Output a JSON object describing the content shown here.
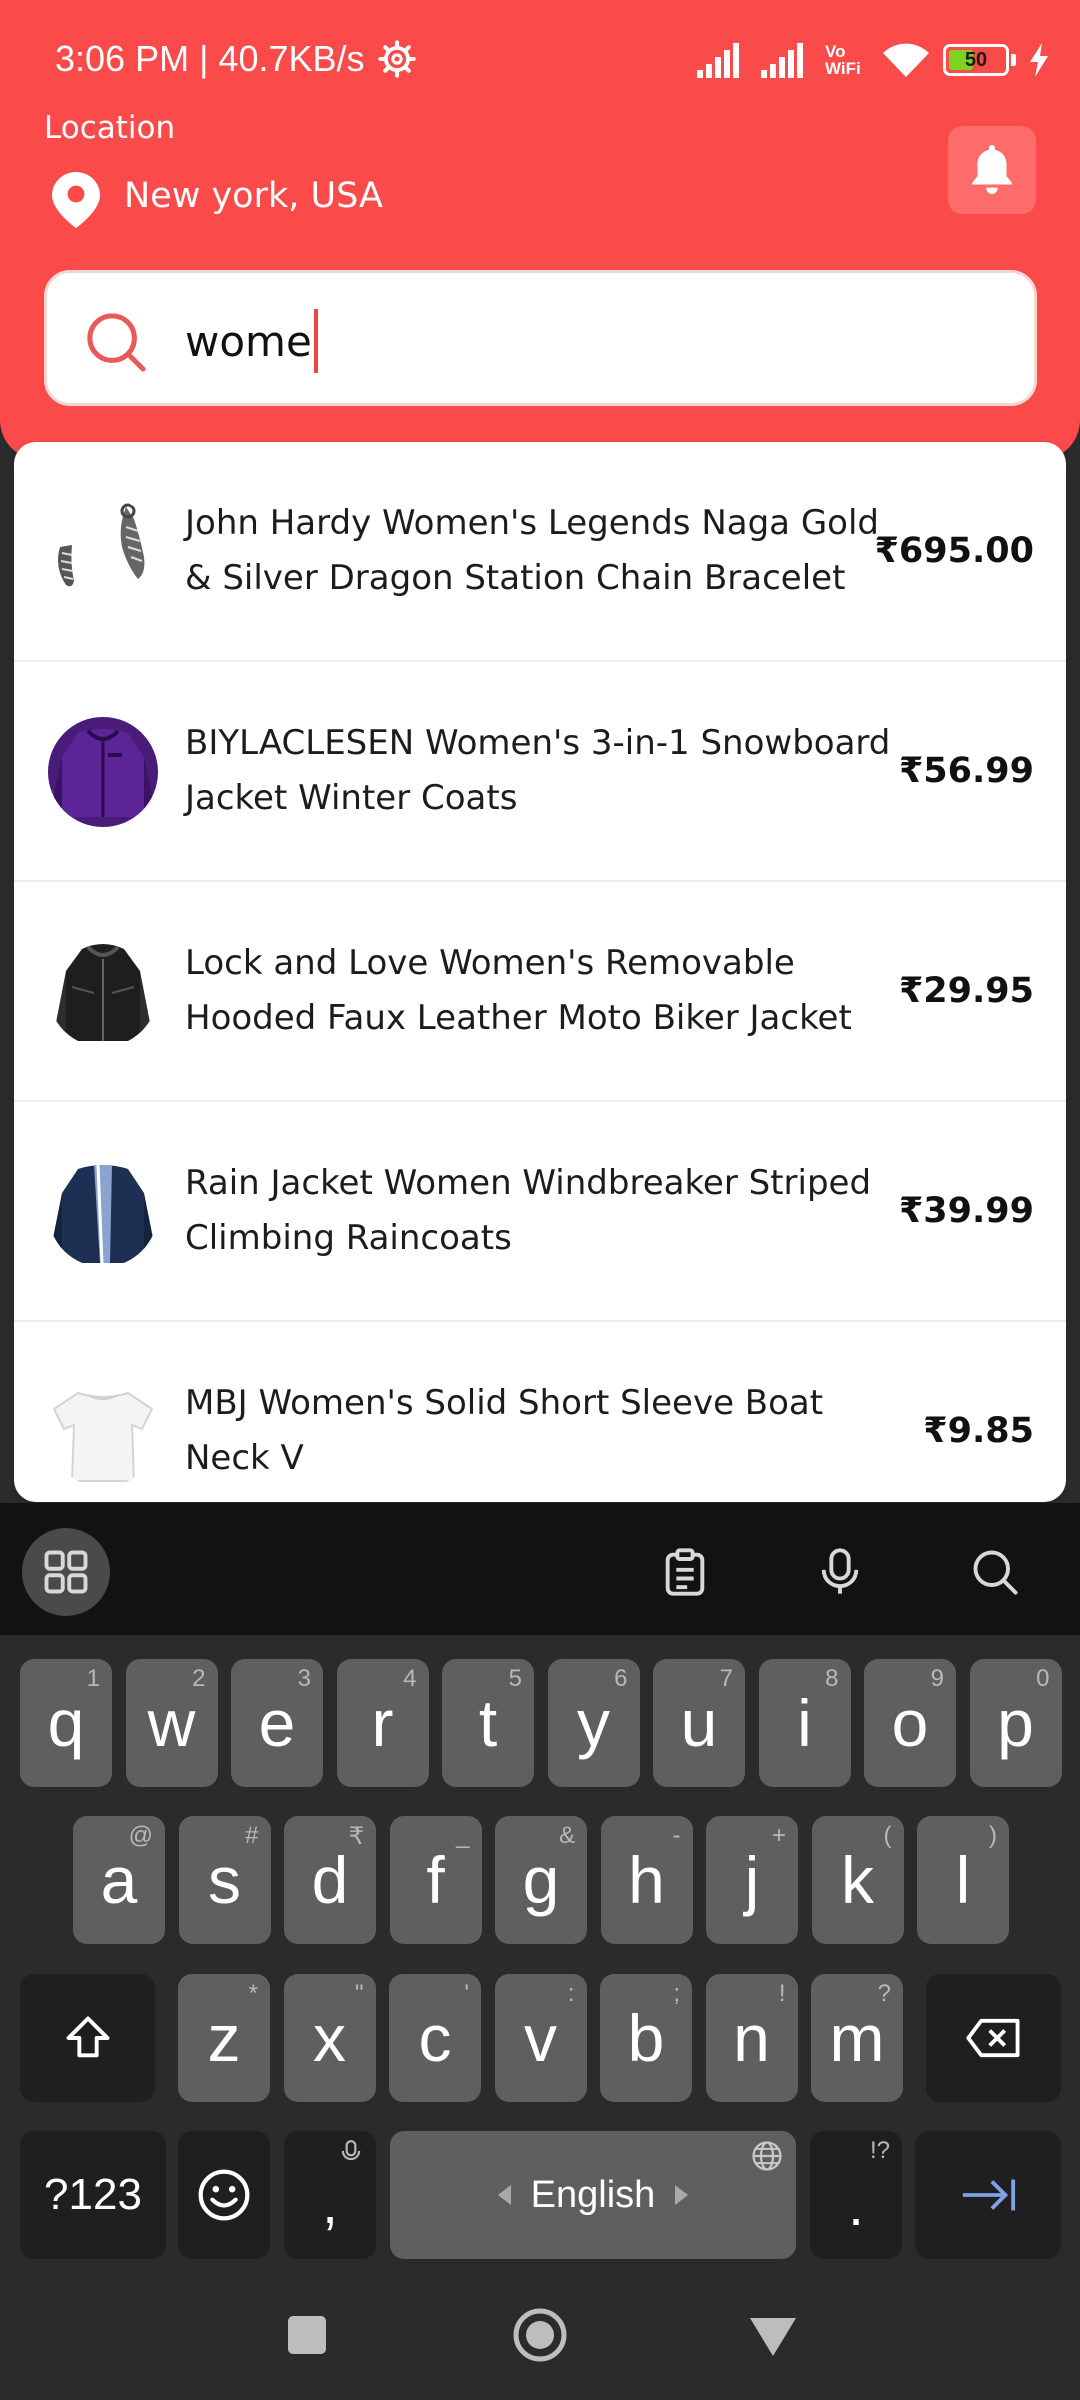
{
  "status_bar": {
    "time": "3:06 PM | 40.7KB/s",
    "vowifi_line1": "Vo",
    "vowifi_line2": "WiFi",
    "battery_level": "50",
    "battery_fraction": 0.5,
    "battery_color": "#7ed321"
  },
  "header": {
    "location_label": "Location",
    "location_value": "New york, USA",
    "accent_color": "#fb4a4a"
  },
  "search": {
    "value": "wome"
  },
  "results": [
    {
      "title": "John Hardy Women's Legends Naga Gold & Silver Dragon Station Chain Bracelet",
      "price": "₹695.00",
      "thumb_icon": "bracelet-thumbnail"
    },
    {
      "title": "BIYLACLESEN Women's 3-in-1 Snowboard Jacket Winter Coats",
      "price": "₹56.99",
      "thumb_icon": "purple-jacket-thumbnail"
    },
    {
      "title": "Lock and Love Women's Removable Hooded Faux Leather Moto Biker Jacket",
      "price": "₹29.95",
      "thumb_icon": "black-leather-jacket-thumbnail"
    },
    {
      "title": "Rain Jacket Women Windbreaker Striped Climbing Raincoats",
      "price": "₹39.99",
      "thumb_icon": "navy-raincoat-thumbnail"
    },
    {
      "title": "MBJ Women's Solid Short Sleeve Boat Neck V",
      "price": "₹9.85",
      "thumb_icon": "white-tshirt-thumbnail"
    }
  ],
  "keyboard": {
    "row1": [
      {
        "k": "q",
        "h": "1"
      },
      {
        "k": "w",
        "h": "2"
      },
      {
        "k": "e",
        "h": "3"
      },
      {
        "k": "r",
        "h": "4"
      },
      {
        "k": "t",
        "h": "5"
      },
      {
        "k": "y",
        "h": "6"
      },
      {
        "k": "u",
        "h": "7"
      },
      {
        "k": "i",
        "h": "8"
      },
      {
        "k": "o",
        "h": "9"
      },
      {
        "k": "p",
        "h": "0"
      }
    ],
    "row2": [
      {
        "k": "a",
        "h": "@"
      },
      {
        "k": "s",
        "h": "#"
      },
      {
        "k": "d",
        "h": "₹"
      },
      {
        "k": "f",
        "h": "_"
      },
      {
        "k": "g",
        "h": "&"
      },
      {
        "k": "h",
        "h": "-"
      },
      {
        "k": "j",
        "h": "+"
      },
      {
        "k": "k",
        "h": "("
      },
      {
        "k": "l",
        "h": ")"
      }
    ],
    "row3": [
      {
        "k": "z",
        "h": "*"
      },
      {
        "k": "x",
        "h": "\""
      },
      {
        "k": "c",
        "h": "'"
      },
      {
        "k": "v",
        "h": ":"
      },
      {
        "k": "b",
        "h": ";"
      },
      {
        "k": "n",
        "h": "!"
      },
      {
        "k": "m",
        "h": "?"
      }
    ],
    "symbols_key": "?123",
    "comma_key": ",",
    "space_label": "English",
    "period_key": ".",
    "period_hint": "!?"
  }
}
